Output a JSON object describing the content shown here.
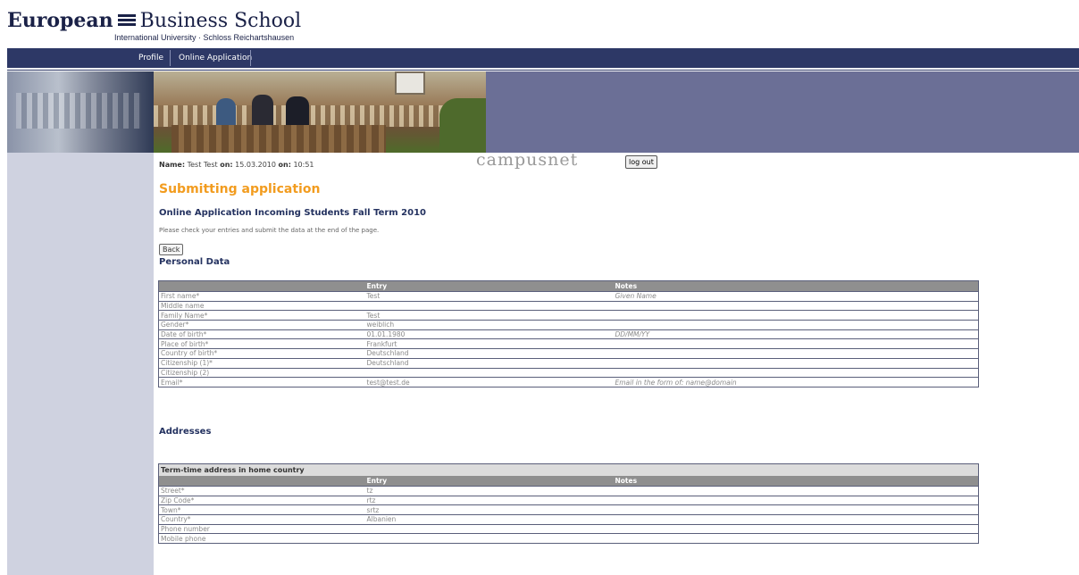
{
  "logo": {
    "name_part1": "European",
    "name_part2": "Business School",
    "subtitle": "International University · Schloss Reichartshausen"
  },
  "nav": {
    "items": [
      {
        "label": "Profile"
      },
      {
        "label": "Online Application"
      }
    ]
  },
  "header": {
    "name_label": "Name:",
    "name_value": "Test Test",
    "on_label": "on:",
    "date_value": "15.03.2010",
    "on_label2": "on:",
    "time_value": "10:51",
    "brand": "campusnet",
    "logout_label": "log out"
  },
  "main": {
    "title": "Submitting application",
    "subtitle": "Online Application Incoming Students Fall Term 2010",
    "instructions": "Please check your entries and submit the data at the end of the page.",
    "back_label": "Back"
  },
  "personal": {
    "heading": "Personal Data",
    "columns": [
      "",
      "Entry",
      "Notes"
    ],
    "rows": [
      {
        "field": "First name*",
        "entry": "Test",
        "note": "Given Name"
      },
      {
        "field": "Middle name",
        "entry": "",
        "note": ""
      },
      {
        "field": "Family Name*",
        "entry": "Test",
        "note": ""
      },
      {
        "field": "Gender*",
        "entry": "weiblich",
        "note": ""
      },
      {
        "field": "Date of birth*",
        "entry": "01.01.1980",
        "note": "DD/MM/YY"
      },
      {
        "field": "Place of birth*",
        "entry": "Frankfurt",
        "note": ""
      },
      {
        "field": "Country of birth*",
        "entry": "Deutschland",
        "note": ""
      },
      {
        "field": "Citizenship (1)*",
        "entry": "Deutschland",
        "note": ""
      },
      {
        "field": "Citizenship (2)",
        "entry": "",
        "note": ""
      },
      {
        "field": "Email*",
        "entry": "test@test.de",
        "note": "Email in the form of: name@domain"
      }
    ]
  },
  "addresses": {
    "heading": "Addresses",
    "table_caption": "Term-time address in home country",
    "columns": [
      "",
      "Entry",
      "Notes"
    ],
    "rows": [
      {
        "field": "Street*",
        "entry": "tz",
        "note": ""
      },
      {
        "field": "Zip Code*",
        "entry": "rtz",
        "note": ""
      },
      {
        "field": "Town*",
        "entry": "srtz",
        "note": ""
      },
      {
        "field": "Country*",
        "entry": "Albanien",
        "note": ""
      },
      {
        "field": "Phone number",
        "entry": "",
        "note": ""
      },
      {
        "field": "Mobile phone",
        "entry": "",
        "note": ""
      }
    ]
  },
  "colors": {
    "nav_bg": "#2d3866",
    "banner_right": "#6b6f96",
    "sidebar_bg": "#cfd2e0",
    "title_orange": "#f29c1f",
    "heading_navy": "#243260",
    "table_header_gray": "#8f8f8f"
  }
}
